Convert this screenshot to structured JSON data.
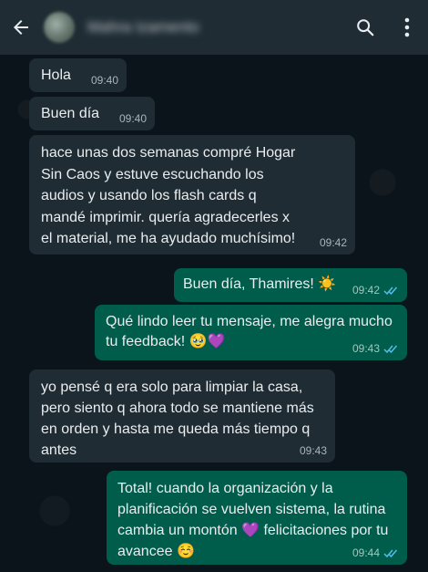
{
  "header": {
    "contact_name": "Mahra Izamento"
  },
  "messages": [
    {
      "direction": "in",
      "text": "Hola",
      "time": "09:40"
    },
    {
      "direction": "in",
      "text": "Buen día",
      "time": "09:40"
    },
    {
      "direction": "in",
      "text": "hace unas dos semanas compré Hogar Sin Caos y estuve escuchando los audios y usando los flash cards q mandé imprimir. quería agradecerles x el material, me ha ayudado muchísimo!",
      "time": "09:42"
    },
    {
      "direction": "out",
      "text": "Buen día, Thamires! ☀️",
      "time": "09:42",
      "read": true
    },
    {
      "direction": "out",
      "text": "Qué lindo leer tu mensaje, me alegra mucho tu feedback! 🥹💜",
      "time": "09:43",
      "read": true
    },
    {
      "direction": "in",
      "text": "yo pensé q era solo para limpiar la casa, pero siento q ahora todo se mantiene más en orden y hasta me queda más tiempo q antes",
      "time": "09:43"
    },
    {
      "direction": "out",
      "text": "Total! cuando la organización y la planificación se vuelven sistema, la rutina cambia un montón 💜 felicitaciones por tu avancee ☺️",
      "time": "09:44",
      "read": true
    }
  ],
  "colors": {
    "incoming_bubble": "#202c33",
    "outgoing_bubble": "#005c4b",
    "read_ticks": "#53bdeb",
    "header_bg": "#1f2c34"
  }
}
